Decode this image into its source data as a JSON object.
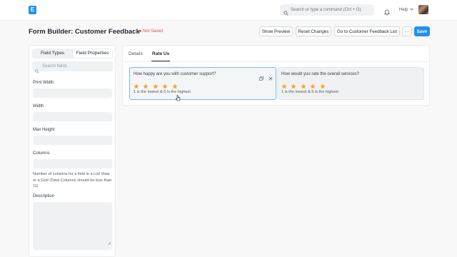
{
  "navbar": {
    "logo_letter": "E",
    "search_placeholder": "Search or type a command (Ctrl + G)",
    "help_label": "Help"
  },
  "header": {
    "title": "Form Builder: Customer Feedback",
    "status": "Not Saved",
    "show_preview": "Show Preview",
    "reset_changes": "Reset Changes",
    "go_to_list": "Go to Customer Feedback List",
    "more": "···",
    "save": "Save"
  },
  "left_panel": {
    "tabs": [
      "Field Types",
      "Field Properties"
    ],
    "active_tab": "Field Properties",
    "search_placeholder": "Search fields",
    "properties": {
      "print_width": "Print Width",
      "width": "Width",
      "max_height": "Max Height",
      "columns": "Columns",
      "columns_help": "Number of columns for a field in a List View or a Grid (Total Columns should be less than 11)",
      "description": "Description"
    }
  },
  "main_panel": {
    "tabs": [
      "Details",
      "Rate Us"
    ],
    "active_tab": "Rate Us",
    "fields": [
      {
        "label": "How happy are you with customer support?",
        "stars": 5,
        "description": "1 is the lowest & 5 is the highest",
        "selected": true
      },
      {
        "label": "How would you rate the overall services?",
        "stars": 5,
        "description": "1 is the lowest & 5 is the highest",
        "selected": false
      }
    ]
  },
  "colors": {
    "primary": "#2490ef",
    "star": "#f5a623",
    "not_saved": "#e24c4c",
    "selected_border": "#7ab8ec"
  },
  "icons": {
    "search": "search-icon",
    "bell": "bell-icon",
    "chevron": "chevron-down-icon",
    "duplicate": "duplicate-icon",
    "close": "close-icon",
    "star": "star-icon",
    "cursor": "pointer-cursor-icon"
  }
}
